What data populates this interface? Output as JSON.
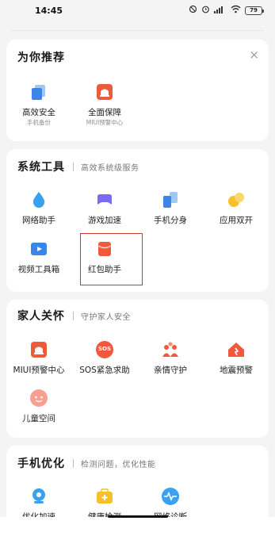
{
  "status_bar": {
    "time": "14:45",
    "signal_text": "⁴⁶",
    "battery": "79"
  },
  "recommend": {
    "title": "为你推荐",
    "close_symbol": "×",
    "items": [
      {
        "label": "高效安全",
        "sublabel": "手机备份",
        "icon": "phone-backup-icon"
      },
      {
        "label": "全面保障",
        "sublabel": "MIUI预警中心",
        "icon": "warning-center-icon"
      }
    ]
  },
  "system_tools": {
    "title": "系统工具",
    "subtitle": "高效系统级服务",
    "items": [
      {
        "label": "网络助手",
        "icon": "water-drop-icon"
      },
      {
        "label": "游戏加速",
        "icon": "gamepad-icon"
      },
      {
        "label": "手机分身",
        "icon": "clone-icon"
      },
      {
        "label": "应用双开",
        "icon": "dual-apps-icon"
      },
      {
        "label": "视频工具箱",
        "icon": "video-toolbox-icon"
      },
      {
        "label": "红包助手",
        "icon": "red-envelope-icon"
      }
    ]
  },
  "family_care": {
    "title": "家人关怀",
    "subtitle": "守护家人安全",
    "items": [
      {
        "label": "MIUI预警中心",
        "icon": "alarm-icon"
      },
      {
        "label": "SOS紧急求助",
        "icon": "sos-icon",
        "badge": "SOS"
      },
      {
        "label": "亲情守护",
        "icon": "family-icon"
      },
      {
        "label": "地震预警",
        "icon": "earthquake-icon"
      },
      {
        "label": "儿童空间",
        "icon": "child-face-icon"
      }
    ]
  },
  "phone_optimize": {
    "title": "手机优化",
    "subtitle": "检测问题，优化性能",
    "items": [
      {
        "label": "优化加速",
        "icon": "rocket-icon"
      },
      {
        "label": "健康检测",
        "icon": "medical-kit-icon"
      },
      {
        "label": "网络诊断",
        "icon": "pulse-icon"
      }
    ]
  },
  "colors": {
    "accent_red": "#f05a3c",
    "accent_blue": "#3aa0f0",
    "accent_purple": "#7a6cf0",
    "accent_yellow": "#f6c02a",
    "highlight_border": "#c83b30"
  }
}
